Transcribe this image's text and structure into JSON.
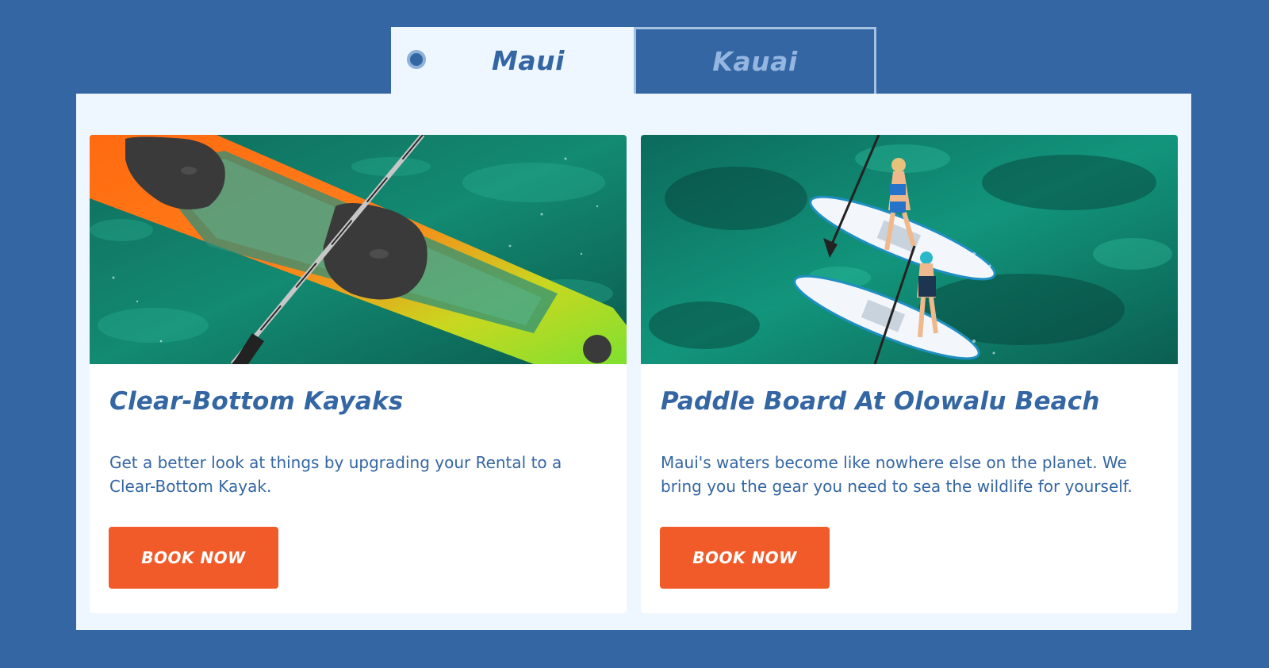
{
  "tabs": [
    {
      "label": "Maui",
      "active": true
    },
    {
      "label": "Kauai",
      "active": false
    }
  ],
  "cards": [
    {
      "image": "clear-bottom-kayak-photo",
      "title": "Clear-Bottom Kayaks",
      "description": "Get a better look at things by upgrading your Rental to a Clear-Bottom Kayak.",
      "button": "BOOK NOW"
    },
    {
      "image": "paddle-boarders-photo",
      "title": "Paddle Board At Olowalu Beach",
      "description": "Maui's waters become like nowhere else on the planet. We bring you the gear you need to sea the wildlife for yourself.",
      "button": "BOOK NOW"
    }
  ],
  "colors": {
    "background": "#3366a3",
    "panel": "#eef6ff",
    "accent": "#f15b29",
    "text": "#3366a3",
    "inactive_tab_text": "#94b6e0"
  }
}
